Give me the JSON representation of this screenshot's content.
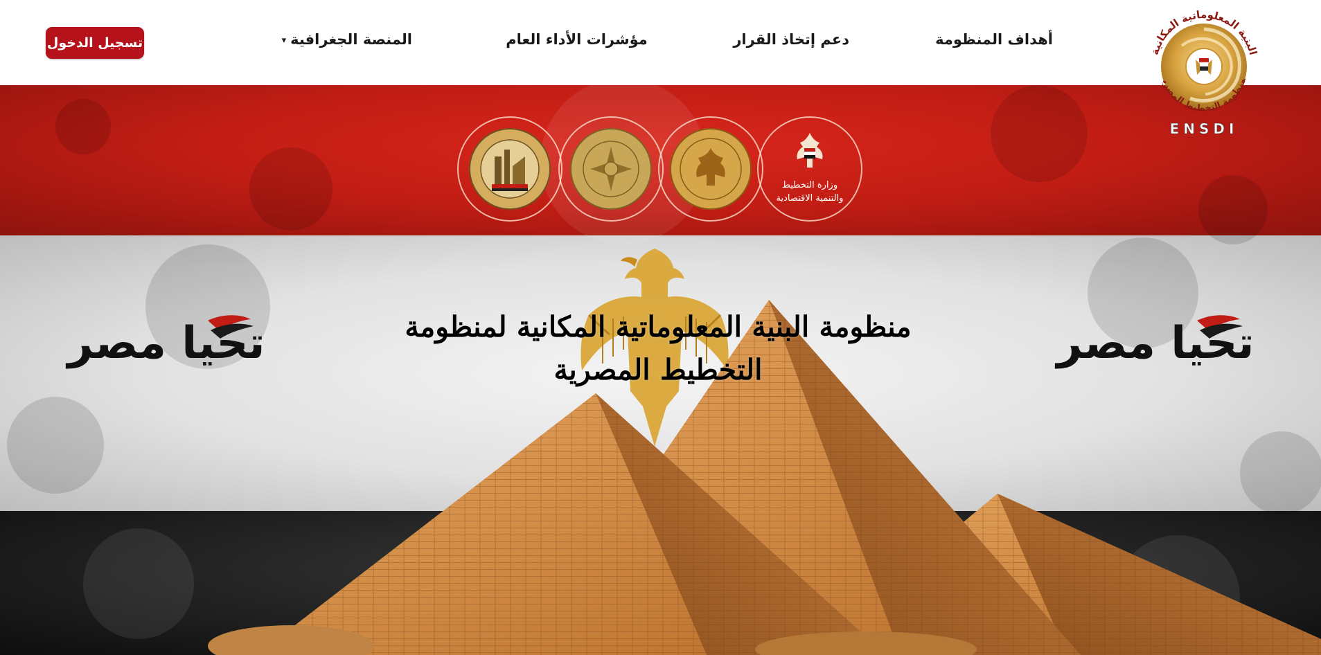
{
  "header": {
    "login_label": "تسجيل الدخول",
    "nav": [
      {
        "label": "أهداف المنظومة"
      },
      {
        "label": "دعم إتخاذ القرار"
      },
      {
        "label": "مؤشرات الأداء العام"
      },
      {
        "label": "المنصة الجغرافية"
      }
    ],
    "nav_dropdown_glyph": "▾"
  },
  "logo": {
    "arc_text": "البنية المعلوماتية المكانية",
    "bottom_text": "لمنظومة التخطيط المصرية",
    "abbr": "ENSDI"
  },
  "hero": {
    "title": "منظومة البنية المعلوماتية المكانية لمنظومة التخطيط المصرية",
    "ministry_line1": "وزارة التخطيط",
    "ministry_line2": "والتنمية الاقتصادية",
    "slogan": "تحيا مصر",
    "colors": {
      "red": "#c11d14",
      "white": "#ececec",
      "black": "#1c1c1c",
      "gold": "#d6a64a",
      "accent": "#b5121b"
    }
  },
  "icons": [
    "egypt-eagle-icon",
    "seal-icon",
    "pyramid-illustration"
  ]
}
